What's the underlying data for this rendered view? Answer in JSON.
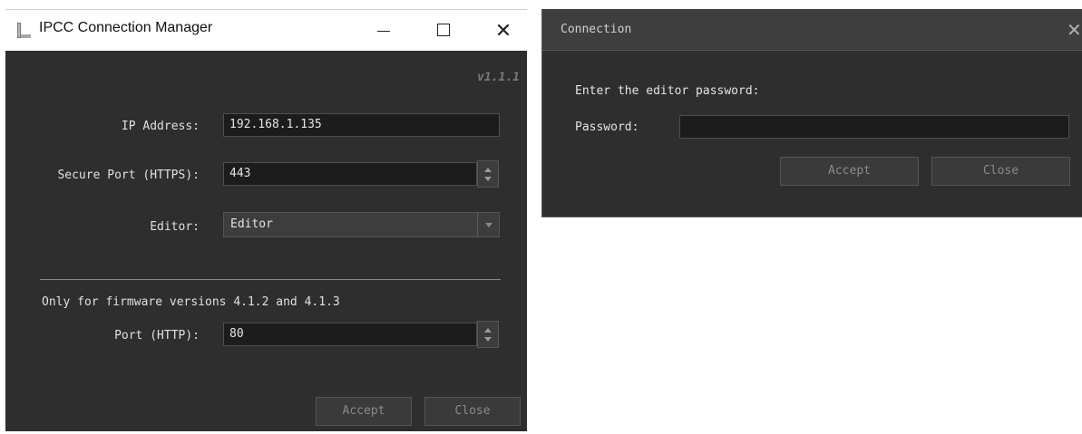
{
  "manager": {
    "title": "IPCC Connection Manager",
    "close_glyph": "✕",
    "version": "v1.1.1",
    "ip_label": "IP Address:",
    "ip_value": "192.168.1.135",
    "secure_port_label": "Secure Port (HTTPS):",
    "secure_port_value": "443",
    "editor_label": "Editor:",
    "editor_value": "Editor",
    "firmware_note": "Only for firmware versions 4.1.2 and 4.1.3",
    "http_port_label": "Port (HTTP):",
    "http_port_value": "80",
    "accept_label": "Accept",
    "close_label": "Close"
  },
  "connection": {
    "title": "Connection",
    "close_glyph": "✕",
    "prompt": "Enter the editor password:",
    "password_label": "Password:",
    "password_value": "",
    "accept_label": "Accept",
    "close_label": "Close"
  },
  "colors": {
    "dialog_bg": "#2e2e2e",
    "field_bg": "#1c1c1c",
    "button_bg": "#3a3a3a",
    "disabled_text": "#8a8a8a",
    "titlebar_dark": "#3e3e3e"
  }
}
